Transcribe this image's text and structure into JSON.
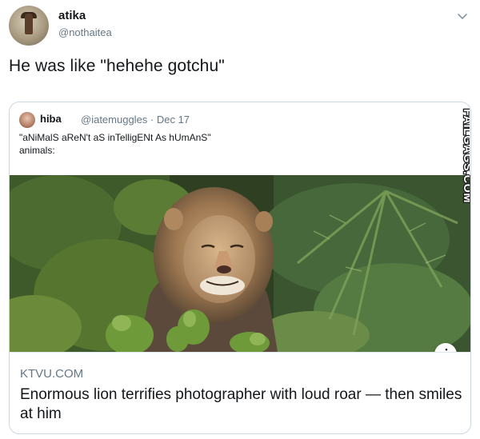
{
  "tweet": {
    "author_name": "atika",
    "author_handle": "@nothaitea",
    "text": "He was like \"hehehe gotchu\""
  },
  "quoted": {
    "author_name": "hiba",
    "author_handle_date": "@iatemuggles · Dec 17",
    "line1": "\"aNiMalS aReN't aS inTelligENt As hUmAnS\"",
    "line2": "animals:"
  },
  "card": {
    "domain": "KTVU.COM",
    "headline": "Enormous lion terrifies photographer with loud roar — then smiles at him",
    "info_icon": "i"
  },
  "watermark": "FAILGAGS.COM",
  "icons": {
    "menu": "chevron-down-icon",
    "info": "info-icon"
  },
  "colors": {
    "text": "#14171a",
    "secondary": "#657786",
    "border": "#ccd6dd"
  }
}
